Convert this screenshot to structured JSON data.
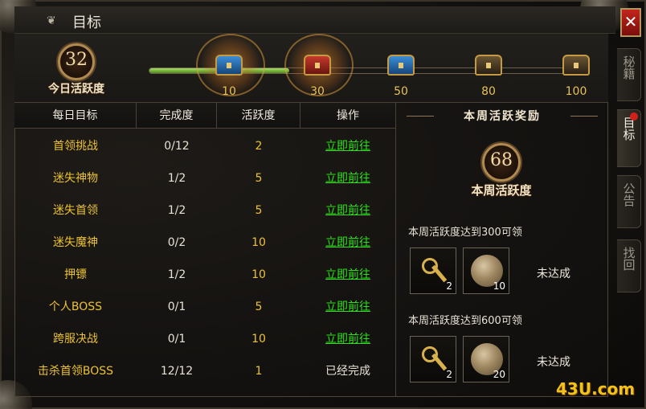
{
  "window": {
    "title": "目标"
  },
  "side_tabs": [
    {
      "label": "秘籍"
    },
    {
      "label": "目标"
    },
    {
      "label": "公告"
    },
    {
      "label": "找回"
    }
  ],
  "daily": {
    "label": "今日活跃度",
    "value": "32",
    "progress_fraction": 0.32,
    "milestones": [
      {
        "value": "10",
        "chest": "blue",
        "reached": true
      },
      {
        "value": "30",
        "chest": "red",
        "reached": true
      },
      {
        "value": "50",
        "chest": "blue",
        "reached": false
      },
      {
        "value": "80",
        "chest": "gold",
        "reached": false
      },
      {
        "value": "100",
        "chest": "gold",
        "reached": false
      }
    ]
  },
  "table": {
    "headers": [
      "每日目标",
      "完成度",
      "活跃度",
      "操作"
    ],
    "rows": [
      {
        "name": "首领挑战",
        "progress": "0/12",
        "points": "2",
        "action": "立即前往",
        "done": false
      },
      {
        "name": "迷失神物",
        "progress": "1/2",
        "points": "5",
        "action": "立即前往",
        "done": false
      },
      {
        "name": "迷失首领",
        "progress": "1/2",
        "points": "5",
        "action": "立即前往",
        "done": false
      },
      {
        "name": "迷失魔神",
        "progress": "0/2",
        "points": "10",
        "action": "立即前往",
        "done": false
      },
      {
        "name": "押镖",
        "progress": "1/2",
        "points": "10",
        "action": "立即前往",
        "done": false
      },
      {
        "name": "个人BOSS",
        "progress": "0/1",
        "points": "5",
        "action": "立即前往",
        "done": false
      },
      {
        "name": "跨服决战",
        "progress": "0/1",
        "points": "10",
        "action": "立即前往",
        "done": false
      },
      {
        "name": "击杀首领BOSS",
        "progress": "12/12",
        "points": "1",
        "action": "已经完成",
        "done": true
      }
    ]
  },
  "weekly": {
    "header": "本周活跃奖励",
    "label": "本周活跃度",
    "value": "68",
    "tiers": [
      {
        "title": "本周活跃度达到300可领",
        "rewards": [
          {
            "icon": "key-icon",
            "count": "2"
          },
          {
            "icon": "stone-icon",
            "count": "10"
          }
        ],
        "status": "未达成"
      },
      {
        "title": "本周活跃度达到600可领",
        "rewards": [
          {
            "icon": "key-icon",
            "count": "2"
          },
          {
            "icon": "stone-icon",
            "count": "20"
          }
        ],
        "status": "未达成"
      }
    ]
  },
  "watermark": "43U.com"
}
